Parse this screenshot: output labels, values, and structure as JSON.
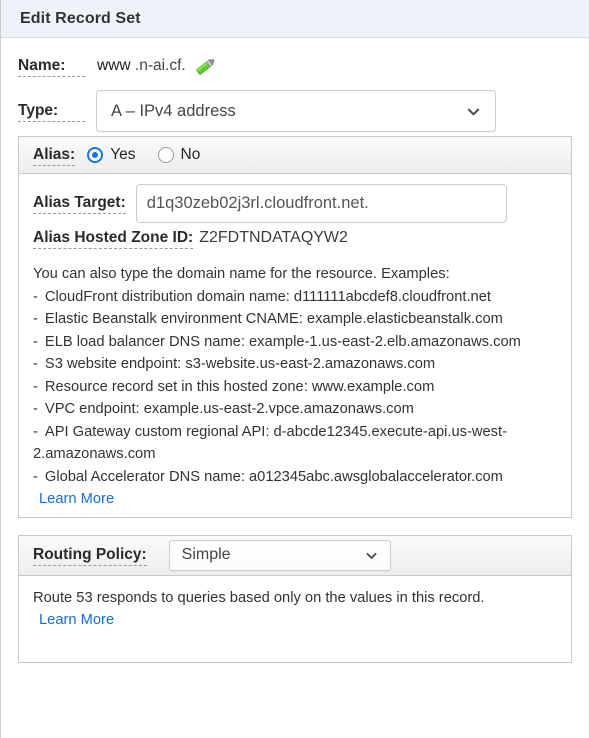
{
  "header": {
    "title": "Edit Record Set"
  },
  "name_field": {
    "label": "Name:",
    "host_value": "www",
    "zone_suffix": ".n-ai.cf.",
    "edit_icon": "pencil-icon"
  },
  "type_field": {
    "label": "Type:",
    "selected": "A – IPv4 address"
  },
  "alias": {
    "label": "Alias:",
    "options": [
      {
        "label": "Yes",
        "selected": true
      },
      {
        "label": "No",
        "selected": false
      }
    ],
    "target_label": "Alias Target:",
    "target_value": "d1q30zeb02j3rl.cloudfront.net.",
    "target_placeholder": "",
    "zone_id_label": "Alias Hosted Zone ID:",
    "zone_id_value": "Z2FDTNDATAQYW2",
    "help_intro": "You can also type the domain name for the resource. Examples:",
    "help_items": [
      "CloudFront distribution domain name: d111111abcdef8.cloudfront.net",
      "Elastic Beanstalk environment CNAME: example.elasticbeanstalk.com",
      "ELB load balancer DNS name: example-1.us-east-2.elb.amazonaws.com",
      "S3 website endpoint: s3-website.us-east-2.amazonaws.com",
      "Resource record set in this hosted zone: www.example.com",
      "VPC endpoint: example.us-east-2.vpce.amazonaws.com",
      "API Gateway custom regional API: d-abcde12345.execute-api.us-west-2.amazonaws.com",
      "Global Accelerator DNS name: a012345abc.awsglobalaccelerator.com"
    ],
    "learn_more": "Learn More",
    "bullet_dash": "-"
  },
  "routing": {
    "label": "Routing Policy:",
    "selected": "Simple",
    "description": "Route 53 responds to queries based only on the values in this record.",
    "learn_more": "Learn More"
  },
  "colors": {
    "header_bg": "#eef3fa",
    "accent_radio": "#1576e0",
    "link": "#1b6dd1",
    "pencil_green": "#5fd02f",
    "panel_border": "#c8c8c8"
  }
}
